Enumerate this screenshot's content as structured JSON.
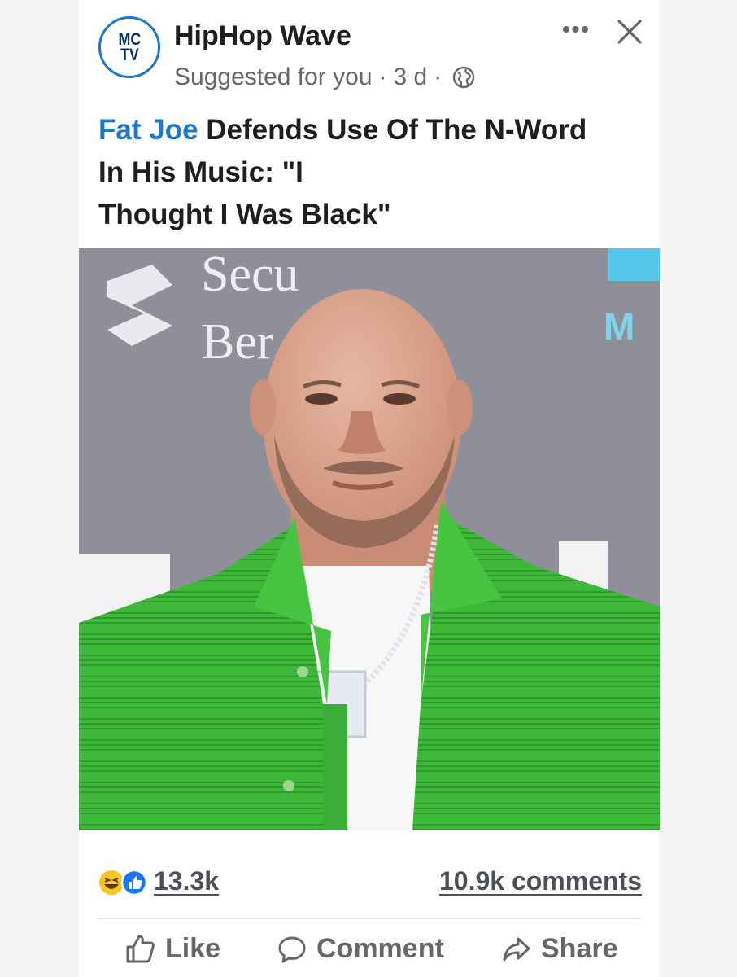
{
  "post": {
    "avatar": {
      "line1": "MC",
      "line2": "TV"
    },
    "page_name": "HipHop Wave",
    "suggested": "Suggested for you",
    "time": "3 d",
    "more_label": "•••",
    "headline": {
      "link_text": "Fat Joe",
      "line1_rest": " Defends Use Of The N-Word",
      "line2": "In His Music: \"I",
      "line3": "Thought I Was Black\""
    },
    "photo": {
      "backdrop_text_1": "Secu",
      "backdrop_text_2": "Ber",
      "backdrop_text_3": "M"
    }
  },
  "stats": {
    "reactions_count": "13.3k",
    "comments_count": "10.9k comments"
  },
  "actions": {
    "like": "Like",
    "comment": "Comment",
    "share": "Share"
  },
  "colors": {
    "link": "#1d78c9",
    "text": "#1c1e21",
    "secondary": "#65676b",
    "shirt": "#3fb33a",
    "backdrop": "#8c8e98"
  },
  "icons": [
    "globe-icon",
    "more-icon",
    "close-icon",
    "haha-reaction-icon",
    "like-reaction-icon",
    "thumbs-up-icon",
    "comment-bubble-icon",
    "share-arrow-icon"
  ]
}
